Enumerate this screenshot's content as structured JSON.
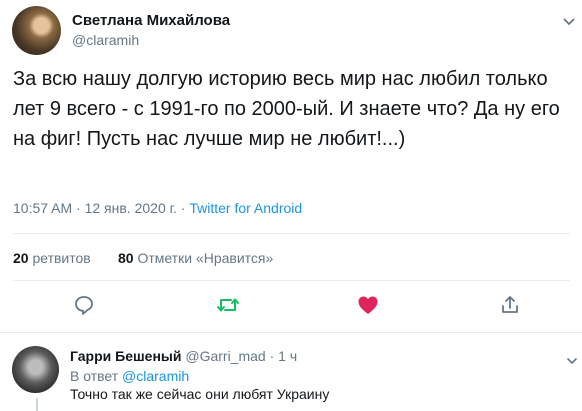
{
  "tweet": {
    "author_name": "Светлана Михайлова",
    "author_handle": "@claramih",
    "text": "За всю нашу долгую историю весь мир нас любил только лет 9 всего - с 1991-го по 2000-ый. И знаете что? Да ну его на фиг!  Пусть нас лучше мир не любит!...)",
    "time": "10:57 AM · 12 янв. 2020 г. · ",
    "source": "Twitter for Android",
    "retweets_count": "20",
    "retweets_label": "ретвитов",
    "likes_count": "80",
    "likes_label": "Отметки «Нравится»",
    "liked_color": "#e0245e",
    "retweet_color": "#17bf63"
  },
  "reply": {
    "author_name": "Гарри Бешеный",
    "author_handle": "@Garri_mad",
    "time": "· 1 ч",
    "reply_prefix": "В ответ ",
    "reply_mention": "@claramih",
    "text": "Точно так же сейчас они любят Украину"
  },
  "icons": [
    "chevron-down-icon",
    "reply-icon",
    "retweet-icon",
    "like-icon",
    "share-icon"
  ]
}
